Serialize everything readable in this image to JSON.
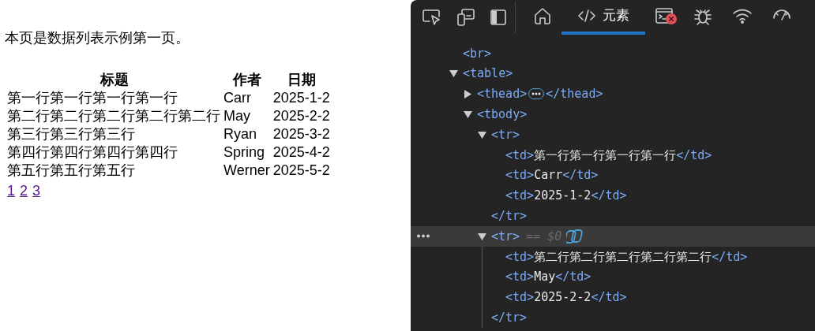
{
  "page": {
    "intro": "本页是数据列表示例第一页。",
    "table": {
      "columns": [
        "标题",
        "作者",
        "日期"
      ],
      "rows": [
        [
          "第一行第一行第一行第一行",
          "Carr",
          "2025-1-2"
        ],
        [
          "第二行第二行第二行第二行第二行",
          "May",
          "2025-2-2"
        ],
        [
          "第三行第三行第三行",
          "Ryan",
          "2025-3-2"
        ],
        [
          "第四行第四行第四行第四行",
          "Spring",
          "2025-4-2"
        ],
        [
          "第五行第五行第五行",
          "Werner",
          "2025-5-2"
        ]
      ]
    },
    "pagination": [
      {
        "label": "1"
      },
      {
        "label": "2"
      },
      {
        "label": "3"
      }
    ]
  },
  "devtools": {
    "tools": [
      {
        "kind": "inspect"
      },
      {
        "kind": "device"
      },
      {
        "kind": "dock"
      }
    ],
    "tabs": [
      {
        "kind": "home",
        "selected": false
      },
      {
        "kind": "elements",
        "label": "元素",
        "selected": true
      },
      {
        "kind": "console",
        "selected": false,
        "error_badge": true
      },
      {
        "kind": "sources",
        "selected": false
      },
      {
        "kind": "network",
        "selected": false
      },
      {
        "kind": "performance",
        "selected": false
      }
    ],
    "dom": [
      {
        "open": "<br>",
        "selected": false
      },
      {
        "open": "<table>",
        "expanded": true,
        "selected": false,
        "children": [
          {
            "open": "<thead>",
            "close": "</thead>",
            "expanded": false,
            "selected": false
          },
          {
            "open": "<tbody>",
            "expanded": true,
            "selected": false,
            "children": [
              {
                "open": "<tr>",
                "close": "</tr>",
                "expanded": true,
                "selected": false,
                "children": [
                  {
                    "open": "<td>",
                    "text": "第一行第一行第一行第一行",
                    "close": "</td>",
                    "selected": false
                  },
                  {
                    "open": "<td>",
                    "text": "Carr",
                    "close": "</td>",
                    "selected": false
                  },
                  {
                    "open": "<td>",
                    "text": "2025-1-2",
                    "close": "</td>",
                    "selected": false
                  }
                ]
              },
              {
                "open": "<tr>",
                "close": "</tr>",
                "expanded": true,
                "selected": true,
                "marker": "== $0",
                "children": [
                  {
                    "open": "<td>",
                    "text": "第二行第二行第二行第二行第二行",
                    "close": "</td>",
                    "selected": false
                  },
                  {
                    "open": "<td>",
                    "text": "May",
                    "close": "</td>",
                    "selected": false
                  },
                  {
                    "open": "<td>",
                    "text": "2025-2-2",
                    "close": "</td>",
                    "selected": false
                  }
                ]
              }
            ]
          }
        ]
      }
    ]
  }
}
